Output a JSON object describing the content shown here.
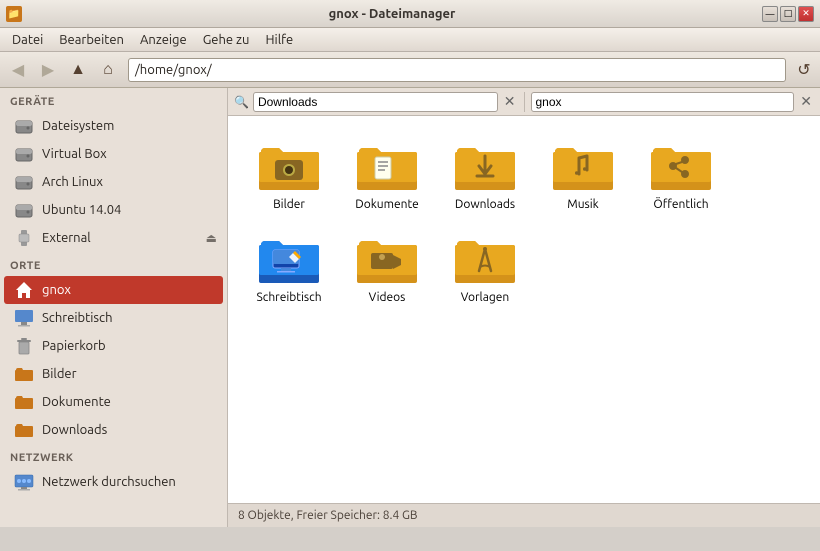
{
  "window": {
    "title": "gnox - Dateimanager",
    "icon": "📁"
  },
  "titlebar_controls": {
    "minimize": "—",
    "maximize": "□",
    "close": "✕"
  },
  "menubar": {
    "items": [
      "Datei",
      "Bearbeiten",
      "Anzeige",
      "Gehe zu",
      "Hilfe"
    ]
  },
  "toolbar": {
    "back_label": "◀",
    "forward_label": "▶",
    "up_label": "▲",
    "home_label": "⌂",
    "location": "/home/gnox/"
  },
  "search": {
    "pane1_value": "Downloads",
    "pane1_placeholder": "Downloads",
    "pane2_value": "gnox",
    "pane2_placeholder": "gnox"
  },
  "sidebar": {
    "geraete_header": "GERÄTE",
    "geraete_items": [
      {
        "label": "Dateisystem",
        "icon": "hdd"
      },
      {
        "label": "Virtual Box",
        "icon": "hdd"
      },
      {
        "label": "Arch Linux",
        "icon": "hdd"
      },
      {
        "label": "Ubuntu 14.04",
        "icon": "hdd"
      },
      {
        "label": "External",
        "icon": "usb",
        "eject": true
      }
    ],
    "orte_header": "ORTE",
    "orte_items": [
      {
        "label": "gnox",
        "icon": "home",
        "active": true
      },
      {
        "label": "Schreibtisch",
        "icon": "desktop"
      },
      {
        "label": "Papierkorb",
        "icon": "trash"
      },
      {
        "label": "Bilder",
        "icon": "pictures"
      },
      {
        "label": "Dokumente",
        "icon": "documents"
      },
      {
        "label": "Downloads",
        "icon": "downloads"
      }
    ],
    "netzwerk_header": "NETZWERK",
    "netzwerk_items": [
      {
        "label": "Netzwerk durchsuchen",
        "icon": "network"
      }
    ]
  },
  "files": [
    {
      "name": "Bilder",
      "type": "pictures"
    },
    {
      "name": "Dokumente",
      "type": "documents"
    },
    {
      "name": "Downloads",
      "type": "downloads"
    },
    {
      "name": "Musik",
      "type": "music"
    },
    {
      "name": "Öffentlich",
      "type": "public"
    },
    {
      "name": "Schreibtisch",
      "type": "desktop-special"
    },
    {
      "name": "Videos",
      "type": "videos"
    },
    {
      "name": "Vorlagen",
      "type": "templates"
    }
  ],
  "statusbar": {
    "text": "8 Objekte, Freier Speicher: 8.4 GB"
  }
}
